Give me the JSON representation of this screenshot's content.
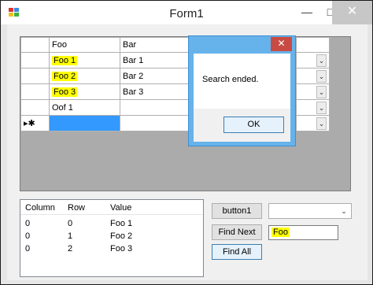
{
  "window": {
    "title": "Form1",
    "minimize_label": "—",
    "maximize_label": "□",
    "close_label": "✕"
  },
  "grid": {
    "columns": [
      "Foo",
      "Bar"
    ],
    "rows": [
      {
        "foo": "Foo 1",
        "bar": "Bar 1"
      },
      {
        "foo": "Foo 2",
        "bar": "Bar 2"
      },
      {
        "foo": "Foo 3",
        "bar": "Bar 3"
      },
      {
        "foo": "Oof 1",
        "bar": ""
      }
    ],
    "new_row_marker": "▸✱",
    "dropdown_arrow": "⌄"
  },
  "dialog": {
    "message": "Search ended.",
    "ok_label": "OK",
    "close_label": "✕"
  },
  "results": {
    "columns": [
      "Column",
      "Row",
      "Value"
    ],
    "rows": [
      {
        "column": "0",
        "row": "0",
        "value": "Foo 1"
      },
      {
        "column": "0",
        "row": "1",
        "value": "Foo 2"
      },
      {
        "column": "0",
        "row": "2",
        "value": "Foo 3"
      }
    ]
  },
  "controls": {
    "button1_label": "button1",
    "find_next_label": "Find Next",
    "find_all_label": "Find All",
    "search_text": "Foo",
    "combo_value": "",
    "combo_arrow": "⌄"
  },
  "colors": {
    "highlight": "#ffff00",
    "selection": "#3399ff",
    "dialog_frame": "#66b2ea",
    "close_red": "#c84b43"
  }
}
